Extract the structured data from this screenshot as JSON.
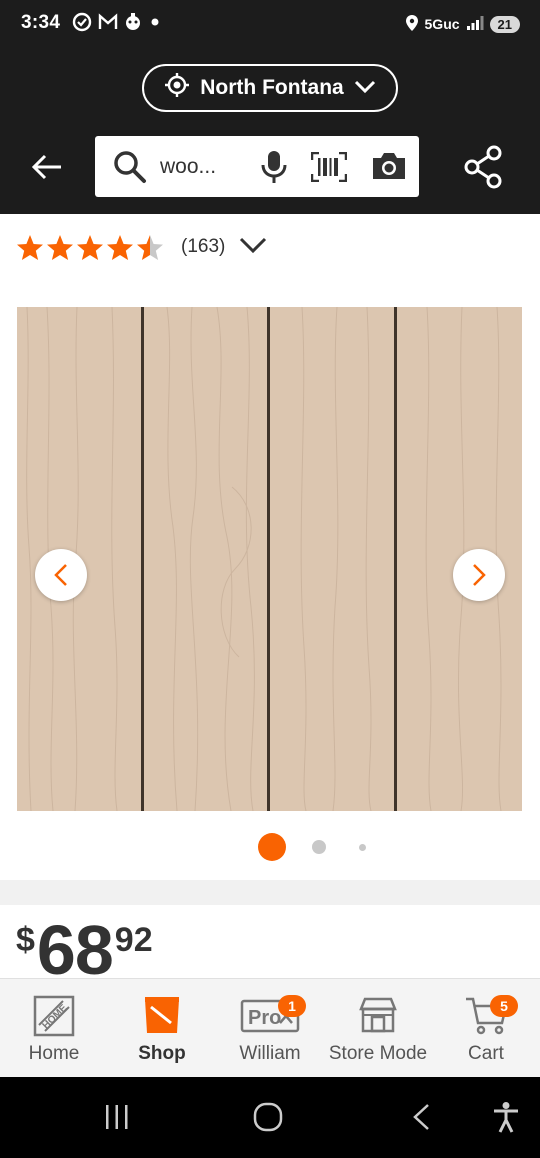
{
  "status_bar": {
    "time": "3:34",
    "left_icons": [
      "nfc-icon",
      "gmail-icon",
      "app-icon",
      "dot-icon"
    ],
    "network": "5Guc",
    "battery": "21"
  },
  "header": {
    "store_name": "North Fontana",
    "search_query": "woo..."
  },
  "product": {
    "rating": 4.5,
    "review_count": "(163)",
    "image_description_colors": {
      "wood": "#dcc6b0",
      "groove": "#3f342a"
    },
    "carousel": {
      "total": 3,
      "active": 0
    }
  },
  "price": {
    "currency": "$",
    "dollars": "68",
    "cents": "92"
  },
  "bottom_nav": {
    "items": [
      {
        "label": "Home",
        "icon": "home-depot-logo-icon",
        "active": false
      },
      {
        "label": "Shop",
        "icon": "shop-bucket-icon",
        "active": true
      },
      {
        "label": "William",
        "icon": "pro-icon",
        "active": false,
        "badge": "1"
      },
      {
        "label": "Store Mode",
        "icon": "store-icon",
        "active": false
      },
      {
        "label": "Cart",
        "icon": "cart-icon",
        "active": false,
        "badge": "5"
      }
    ]
  },
  "colors": {
    "accent": "#f96302",
    "header_bg": "#1c1c1c",
    "star": "#f96302"
  }
}
